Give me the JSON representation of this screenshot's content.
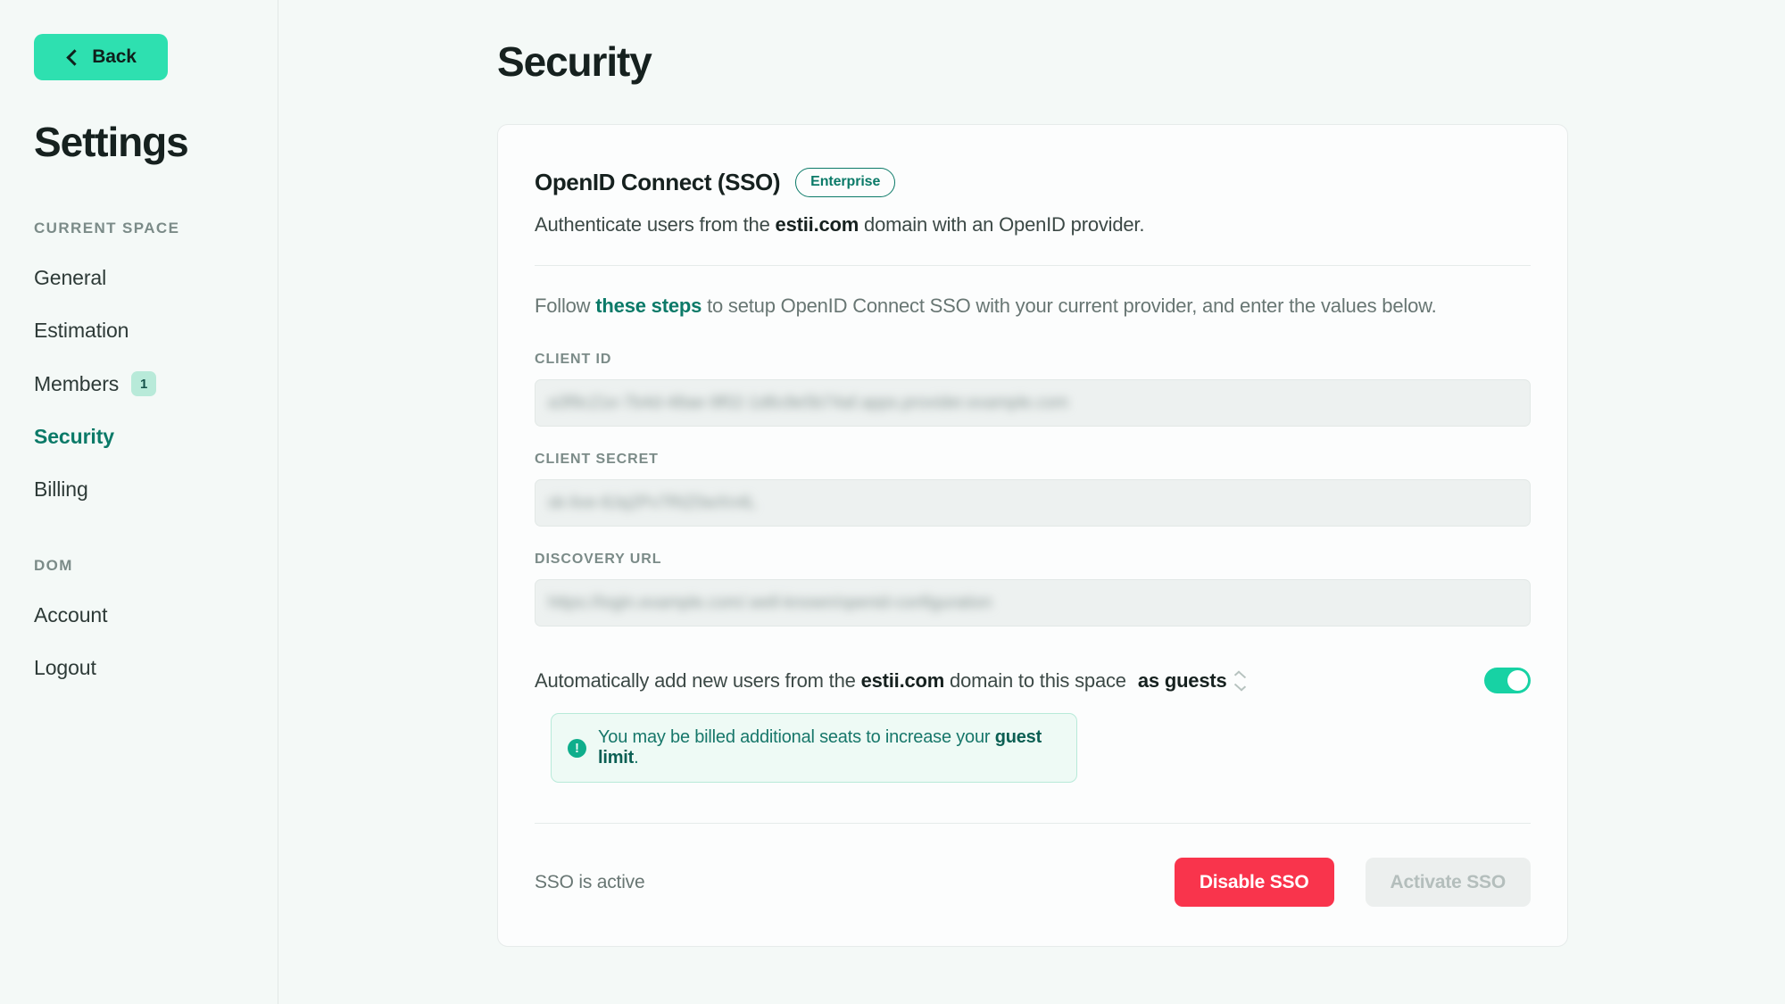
{
  "sidebar": {
    "back_label": "Back",
    "title": "Settings",
    "section_current_space": "CURRENT SPACE",
    "section_dom": "DOM",
    "items_space": [
      {
        "label": "General",
        "badge": null,
        "active": false
      },
      {
        "label": "Estimation",
        "badge": null,
        "active": false
      },
      {
        "label": "Members",
        "badge": "1",
        "active": false
      },
      {
        "label": "Security",
        "badge": null,
        "active": true
      },
      {
        "label": "Billing",
        "badge": null,
        "active": false
      }
    ],
    "items_dom": [
      {
        "label": "Account"
      },
      {
        "label": "Logout"
      }
    ]
  },
  "page": {
    "title": "Security"
  },
  "card": {
    "title": "OpenID Connect (SSO)",
    "badge": "Enterprise",
    "subtitle_prefix": "Authenticate users from the ",
    "subtitle_domain": "estii.com",
    "subtitle_suffix": " domain with an OpenID provider.",
    "follow_prefix": "Follow ",
    "follow_link": "these steps",
    "follow_suffix": " to setup OpenID Connect SSO with your current provider, and enter the values below.",
    "fields": [
      {
        "label": "CLIENT ID",
        "value": "a3f9c21e-7b4d-48ae-9f02-1d6c8e5b74af.apps.provider.example.com",
        "placeholder": ""
      },
      {
        "label": "CLIENT SECRET",
        "value": "sk-live-8Jq2Pv7RtZ0wXn4L",
        "placeholder": ""
      },
      {
        "label": "DISCOVERY URL",
        "value": "https://login.example.com/.well-known/openid-configuration",
        "placeholder": ""
      }
    ],
    "auto_add": {
      "text_prefix": "Automatically add new users from the ",
      "domain": "estii.com",
      "text_middle": " domain to this space",
      "role_value": "as guests",
      "toggle_on": true
    },
    "notice": {
      "icon": "alert-circle-icon",
      "text_prefix": "You may be billed additional seats to increase your ",
      "text_bold": "guest limit",
      "text_suffix": "."
    },
    "footer": {
      "status": "SSO is active",
      "disable_label": "Disable SSO",
      "activate_label": "Activate SSO"
    }
  },
  "colors": {
    "accent_teal": "#2ee0b0",
    "brand_dark_teal": "#0b7a68",
    "danger_red": "#f9344c",
    "page_bg": "#f4f9f7",
    "card_bg": "#fcfdfd"
  }
}
